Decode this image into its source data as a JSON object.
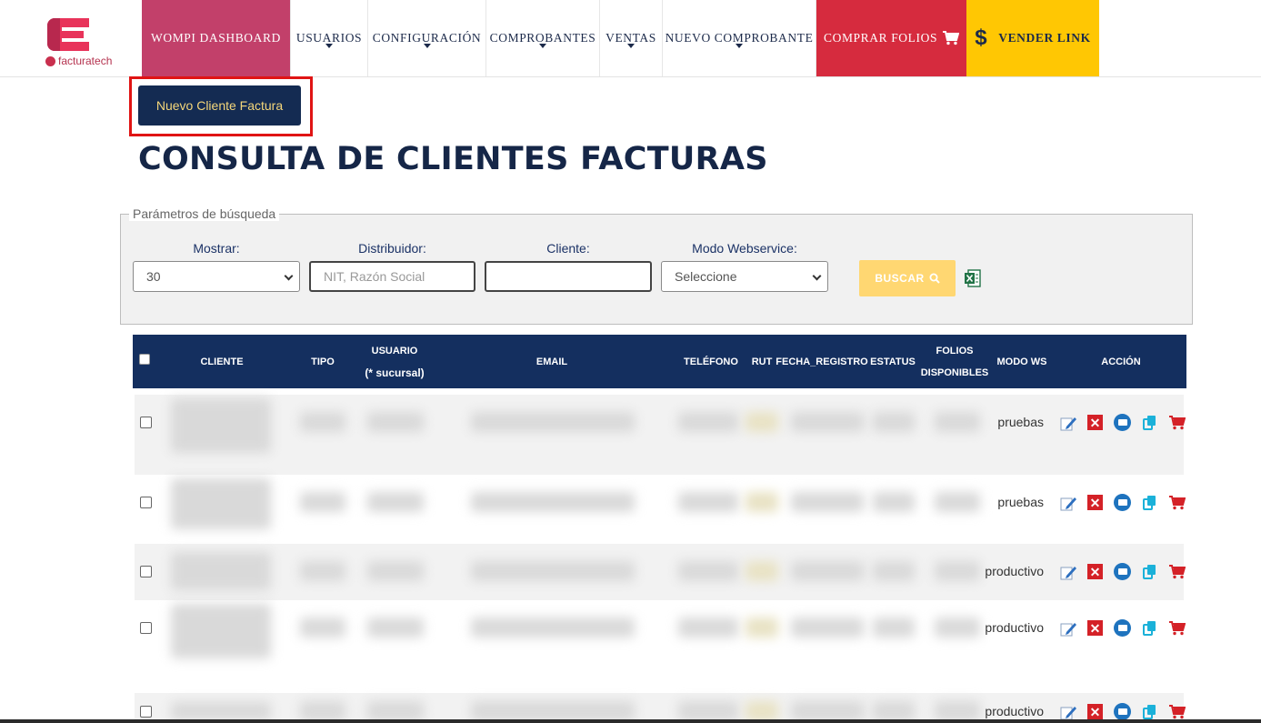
{
  "brand": {
    "name": "facturatech",
    "color": "#c2406a"
  },
  "nav": {
    "wompi": "WOMPI",
    "dashboard": "DASHBOARD",
    "usuarios": "USUARIOS",
    "configuracion": "CONFIGURACIÓN",
    "comprobantes": "COMPROBANTES",
    "ventas": "VENTAS",
    "nuevo_comprobante": "NUEVO COMPROBANTE",
    "comprar_folios": "COMPRAR FOLIOS",
    "vender_link": "VENDER LINK",
    "dollar_icon": "$",
    "cart_icon": "cart-icon"
  },
  "new_client_button": "Nuevo Cliente Factura",
  "page_title": "CONSULTA DE CLIENTES FACTURAS",
  "search": {
    "legend": "Parámetros de búsqueda",
    "mostrar_label": "Mostrar:",
    "mostrar_value": "30",
    "distribuidor_label": "Distribuidor:",
    "distribuidor_placeholder": "NIT, Razón Social",
    "cliente_label": "Cliente:",
    "cliente_value": "",
    "modo_label": "Modo Webservice:",
    "modo_value": "Seleccione",
    "buscar": "BUSCAR"
  },
  "table": {
    "headers": {
      "cliente": "CLIENTE",
      "tipo": "TIPO",
      "usuario": "USUARIO",
      "usuario_sub": "(* sucursal)",
      "email": "EMAIL",
      "telefono": "TELÉFONO",
      "rut": "RUT",
      "fecha": "FECHA_REGISTRO",
      "estatus": "ESTATUS",
      "folios": "FOLIOS",
      "folios_sub": "DISPONIBLES",
      "modo_ws": "MODO WS",
      "accion": "ACCIÓN"
    },
    "rows": [
      {
        "modo_ws": "pruebas"
      },
      {
        "modo_ws": "pruebas"
      },
      {
        "modo_ws": "productivo"
      },
      {
        "modo_ws": "productivo"
      },
      {
        "modo_ws": "productivo"
      }
    ]
  },
  "colors": {
    "navy": "#142f5f",
    "red": "#d62b3e",
    "yellow": "#ffc703",
    "buscar": "#ffd772"
  }
}
